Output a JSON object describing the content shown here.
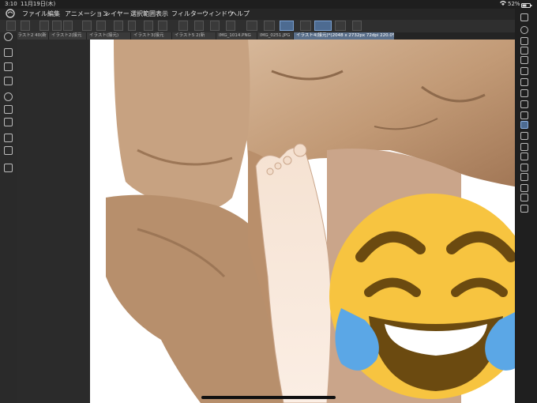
{
  "status": {
    "time": "3:10",
    "date": "11月19日(木)",
    "battery": "52%"
  },
  "menu": [
    "ファイル",
    "編集",
    "アニメーション",
    "レイヤー",
    "選択範囲",
    "表示",
    "フィルター",
    "ウィンドウ",
    "ヘルプ"
  ],
  "tabs": [
    {
      "label": "イラスト2 40(新"
    },
    {
      "label": "イラスト2(接元"
    },
    {
      "label": "イラスト(接元)"
    },
    {
      "label": "イラスト3(接元"
    },
    {
      "label": "イラスト5 2(新"
    },
    {
      "label": "IMG_1014.PNG"
    },
    {
      "label": "IMG_0251.JPG"
    },
    {
      "label": "イラスト4(接元)*(2048 x 2732px 72dpi 220.0%)"
    }
  ],
  "icons": {
    "app": "clip-studio-logo-icon",
    "wifi": "wifi-icon",
    "battery": "battery-icon",
    "emoji": "face-with-tears-of-joy-emoji"
  },
  "colors": {
    "emoji_yellow": "#f7c440",
    "emoji_brown": "#6b4a10",
    "tear_blue": "#5ba7e6",
    "accent": "#4d6b91"
  }
}
